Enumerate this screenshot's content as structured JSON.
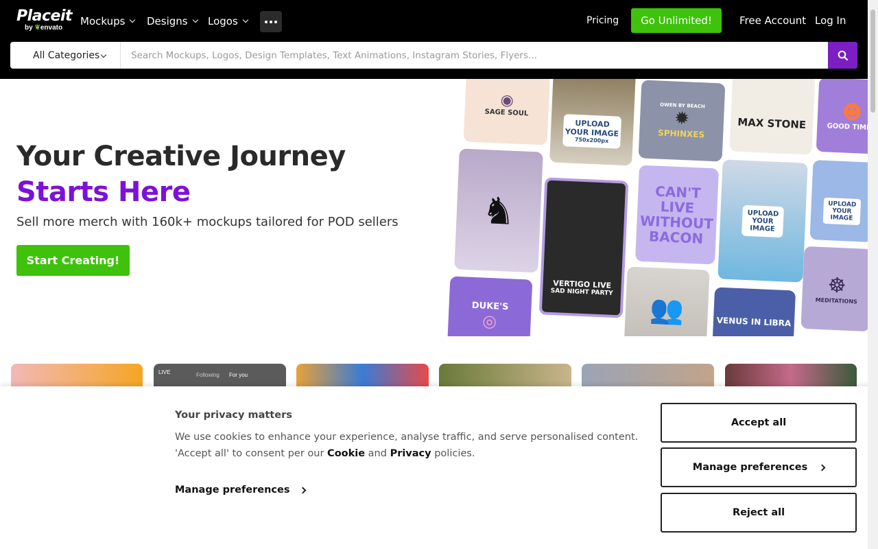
{
  "brand": {
    "name": "Placeit",
    "by": "by",
    "sub": "envato"
  },
  "nav": {
    "items": [
      {
        "label": "Mockups"
      },
      {
        "label": "Designs"
      },
      {
        "label": "Logos"
      }
    ],
    "pricing": "Pricing",
    "unlimited": "Go Unlimited!",
    "free_account": "Free Account",
    "login": "Log In"
  },
  "search": {
    "category": "All Categories",
    "placeholder": "Search Mockups, Logos, Design Templates, Text Animations, Instagram Stories, Flyers..."
  },
  "hero": {
    "title1": "Your Creative Journey",
    "title2": "Starts Here",
    "subtitle": "Sell more merch with 160k+ mockups tailored for POD sellers",
    "cta": "Start Creating!"
  },
  "collage": {
    "t1": "SAGE SOUL",
    "t2": "UPLOAD YOUR IMAGE",
    "t2b": "750x200px",
    "t3": "SPHINXES",
    "t3top": "OWEN BY BEACH",
    "t4": "MAX STONE",
    "t5": "GOOD TIMES",
    "t7a": "VERTIGO LIVE",
    "t7b": "SAD NIGHT PARTY",
    "t8": "CAN'T LIVE WITHOUT BACON",
    "t9": "UPLOAD YOUR IMAGE",
    "t10": "UPLOAD YOUR IMAGE",
    "t11": "DUKE'S",
    "t13": "VENUS IN LIBRA",
    "t14": "MEDITATIONS",
    "t15": "LIVE",
    "t15a": "Following",
    "t15b": "For you"
  },
  "cookie": {
    "title": "Your privacy matters",
    "body1": "We use cookies to enhance your experience, analyse traffic, and serve personalised content. 'Accept all' to consent per our",
    "cookie_word": "Cookie",
    "and_word": "and",
    "privacy_word": "Privacy",
    "policies_word": "policies.",
    "manage_link": "Manage preferences",
    "accept": "Accept all",
    "manage_btn": "Manage preferences",
    "reject": "Reject all"
  },
  "colors": {
    "accent_green": "#3ec20b",
    "accent_purple": "#7c12d8",
    "topbar": "#000000"
  },
  "icons": [
    "chevron-down-icon",
    "more-icon",
    "search-icon",
    "chevron-right-icon"
  ]
}
